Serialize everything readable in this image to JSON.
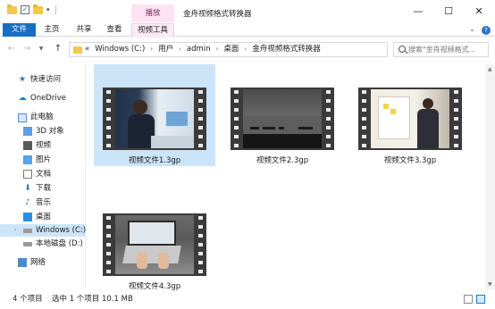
{
  "titlebar": {
    "qat_check": "✓",
    "context_group": "播放",
    "title": "金舟视频格式转换器",
    "minimize": "—",
    "maximize": "☐",
    "close": "✕"
  },
  "ribbon": {
    "tabs": [
      "文件",
      "主页",
      "共享",
      "查看",
      "视频工具"
    ],
    "collapse_icon": "⌄",
    "help_icon": "?"
  },
  "address": {
    "back": "←",
    "forward": "→",
    "recent": "▼",
    "up": "↑",
    "overflow": "«",
    "crumbs": [
      "Windows (C:)",
      "用户",
      "admin",
      "桌面",
      "金舟视频格式转换器"
    ],
    "separator": "›",
    "dropdown": "⌄",
    "refresh": "↻",
    "search_placeholder": "搜索\"金舟视频格式..."
  },
  "sidebar": {
    "items": [
      {
        "label": "快速访问",
        "icon": "star-icon"
      },
      {
        "label": "OneDrive",
        "icon": "cloud-icon"
      },
      {
        "label": "此电脑",
        "icon": "computer-icon"
      },
      {
        "label": "3D 对象",
        "icon": "3d-objects-icon"
      },
      {
        "label": "视频",
        "icon": "videos-folder-icon"
      },
      {
        "label": "图片",
        "icon": "pictures-folder-icon"
      },
      {
        "label": "文档",
        "icon": "documents-folder-icon"
      },
      {
        "label": "下载",
        "icon": "downloads-folder-icon"
      },
      {
        "label": "音乐",
        "icon": "music-folder-icon"
      },
      {
        "label": "桌面",
        "icon": "desktop-folder-icon"
      },
      {
        "label": "Windows (C:)",
        "icon": "system-drive-icon"
      },
      {
        "label": "本地磁盘 (D:)",
        "icon": "local-disk-icon"
      },
      {
        "label": "网络",
        "icon": "network-icon"
      }
    ],
    "star_glyph": "★",
    "cloud_glyph": "☁",
    "down_glyph": "⬇",
    "music_glyph": "♪",
    "expand_glyph": "›"
  },
  "files": [
    {
      "name": "视频文件1.3gp",
      "selected": true
    },
    {
      "name": "视频文件2.3gp",
      "selected": false
    },
    {
      "name": "视频文件3.3gp",
      "selected": false
    },
    {
      "name": "视频文件4.3gp",
      "selected": false
    }
  ],
  "status": {
    "count": "4 个项目",
    "selected": "选中 1 个项目",
    "size": "10.1 MB"
  },
  "scroll": {
    "up": "▲",
    "down": "▼"
  },
  "colors": {
    "accent": "#1a6ec1",
    "selection": "#cce4f7",
    "context_tab": "#fce4f2",
    "filmstrip": "#3b3b3b"
  }
}
